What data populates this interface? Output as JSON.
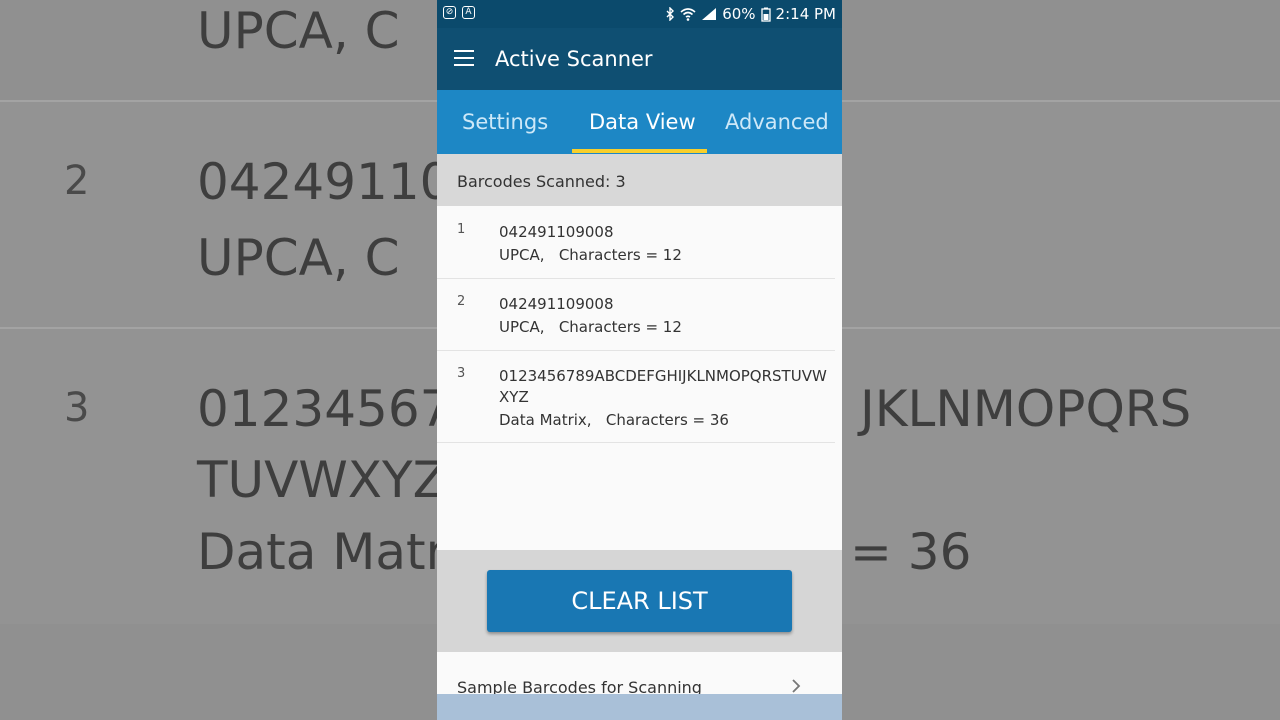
{
  "status_bar": {
    "battery": "60%",
    "time": "2:14 PM",
    "left_icons": [
      "blocked-icon",
      "a-icon"
    ],
    "right_icons": [
      "bluetooth-icon",
      "wifi-icon",
      "signal-icon",
      "battery-icon"
    ]
  },
  "app_bar": {
    "title": "Active Scanner"
  },
  "tabs": [
    {
      "label": "Settings"
    },
    {
      "label": "Data View"
    },
    {
      "label": "Advanced"
    }
  ],
  "summary": {
    "text": "Barcodes Scanned: 3"
  },
  "barcodes": [
    {
      "index": "1",
      "code": "042491109008",
      "meta": "UPCA,   Characters = 12"
    },
    {
      "index": "2",
      "code": "042491109008",
      "meta": "UPCA,   Characters = 12"
    },
    {
      "index": "3",
      "code": "0123456789ABCDEFGHIJKLNMOPQRSTUVWXYZ",
      "meta": "Data Matrix,   Characters = 36"
    }
  ],
  "clear_button": {
    "label": "CLEAR LIST"
  },
  "sample_link": {
    "label": "Sample Barcodes for Scanning"
  },
  "background_fragments": {
    "row1_text": "UPCA,    C",
    "row2_num": "2",
    "row2_text1": "04249110",
    "row2_text2": "UPCA,    C",
    "row3_num": "3",
    "row3_text1": "01234567",
    "row3_text1_right": "JKLNMOPQRS",
    "row3_text2": "TUVWXYZ",
    "row3_text3": "Data Matr",
    "row3_text3_right": "= 36"
  },
  "colors": {
    "app_bar": "#0f4f72",
    "tabs": "#1d87c5",
    "tab_indicator": "#f8cf2b",
    "button": "#1977b3"
  }
}
